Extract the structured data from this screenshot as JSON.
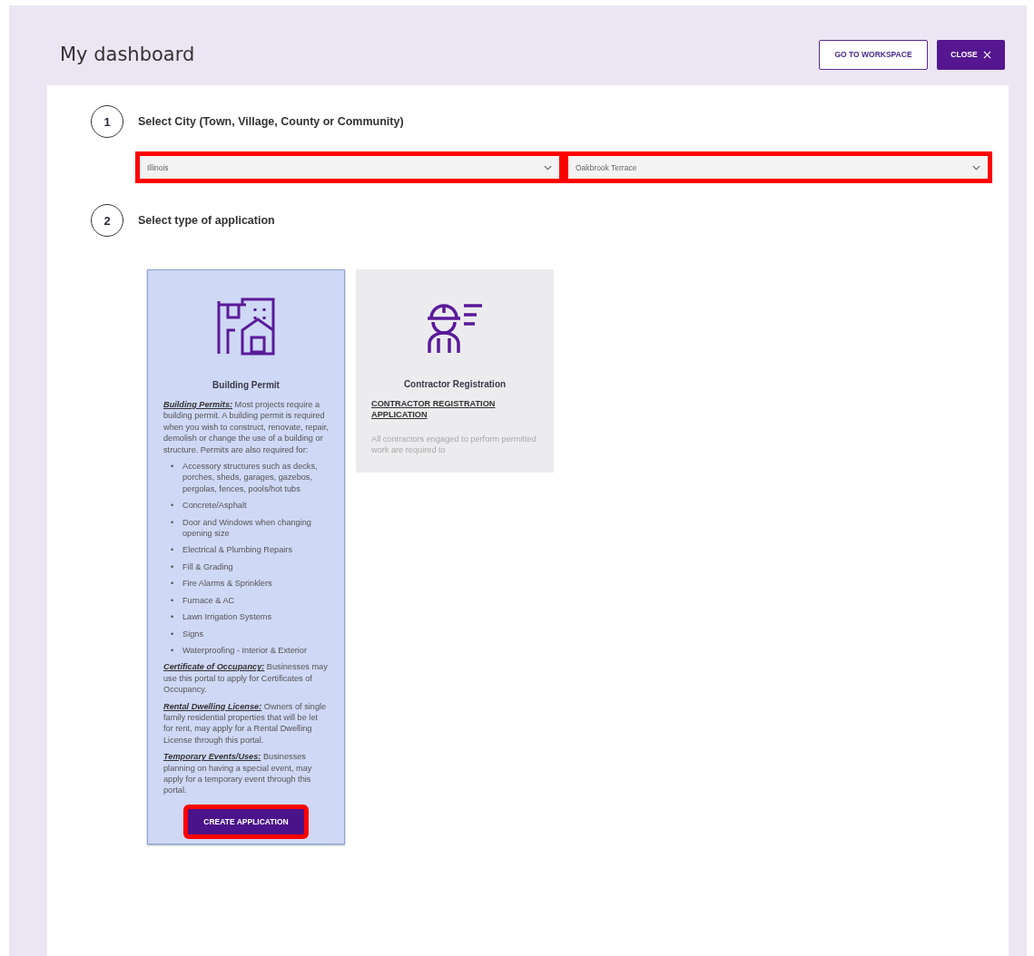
{
  "header": {
    "title": "My dashboard",
    "buttons": [
      {
        "label": "GO TO WORKSPACE",
        "kind": "outline"
      },
      {
        "label": "CLOSE",
        "kind": "close"
      }
    ]
  },
  "steps": [
    {
      "number": "1",
      "title": "Select City (Town, Village, County or Community)"
    },
    {
      "number": "2",
      "title": "Select type of application"
    }
  ],
  "dropdowns": [
    {
      "value": "Illinois",
      "highlighted": true
    },
    {
      "value": "Oakbrook Terrace",
      "highlighted": true
    }
  ],
  "cards": [
    {
      "title": "Building Permit",
      "selected": true,
      "body": [
        {
          "kind": "paragraph",
          "text": "**Building Permits:**  Most projects require a building permit.   A building permit is required when you wish to construct, renovate, repair, demolish or change the use of a building or structure. Permits are also required for:"
        },
        {
          "kind": "list",
          "marker": "•",
          "items": [
            "Accessory structures such as decks, porches, sheds, garages, gazebos, pergolas, fences, pools/hot tubs",
            "Concrete/Asphalt",
            "Door and Windows when changing opening size",
            "Electrical & Plumbing Repairs",
            "Fill & Grading",
            "Fire Alarms & Sprinklers",
            "Furnace & AC",
            "Lawn Irrigation Systems",
            "Signs",
            "Waterproofing - Interior & Exterior"
          ]
        },
        {
          "kind": "paragraph",
          "text": "**Certificate of Occupancy:**  Businesses may use this portal to apply for Certificates of Occupancy."
        },
        {
          "kind": "paragraph",
          "text": "**Rental Dwelling License:**  Owners of single family residential properties that will be let for rent, may apply for a Rental Dwelling License through this portal."
        },
        {
          "kind": "paragraph",
          "text": "**Temporary Events/Uses:**  Businesses planning on having a special event, may apply for a temporary event through this portal."
        }
      ],
      "button": {
        "label": "CREATE APPLICATION",
        "highlighted": true
      }
    },
    {
      "title": "Contractor Registration",
      "selected": false,
      "body": [
        {
          "kind": "link",
          "text": "CONTRACTOR REGISTRATION APPLICATION"
        },
        {
          "kind": "faded",
          "text": "All contractors engaged to perform permitted work are required to"
        }
      ]
    }
  ]
}
